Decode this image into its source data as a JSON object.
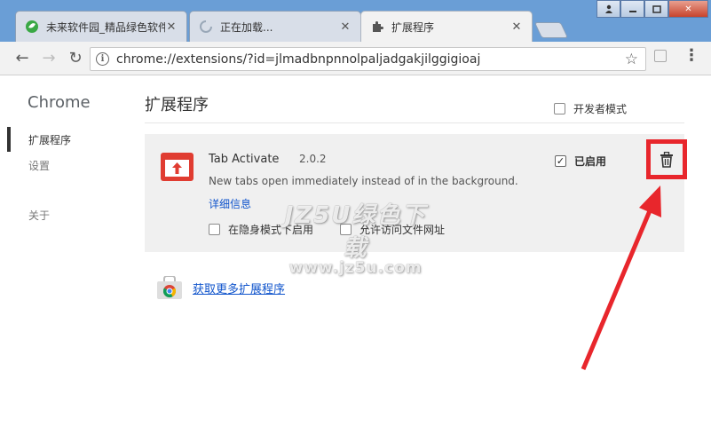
{
  "tabs": [
    {
      "title": "未来软件园_精品绿色软件",
      "icon": "site-leaf-icon",
      "active": false
    },
    {
      "title": "正在加载...",
      "icon": "loading-spinner-icon",
      "active": false
    },
    {
      "title": "扩展程序",
      "icon": "puzzle-piece-icon",
      "active": true
    }
  ],
  "window_controls": {
    "user": "user-icon",
    "minimize": "minimize-icon",
    "restore": "restore-icon",
    "close": "close-icon"
  },
  "omnibox": {
    "url": "chrome://extensions/?id=jlmadbnpnnolpaljadgakjilggigioaj"
  },
  "sidebar": {
    "brand": "Chrome",
    "items": [
      {
        "label": "扩展程序",
        "active": true
      },
      {
        "label": "设置",
        "active": false
      },
      {
        "label": "关于",
        "active": false
      }
    ]
  },
  "main": {
    "title": "扩展程序",
    "developer_mode_label": "开发者模式",
    "extension": {
      "name": "Tab Activate",
      "version": "2.0.2",
      "description": "New tabs open immediately instead of in the background.",
      "details_link": "详细信息",
      "incognito_label": "在隐身模式下启用",
      "file_urls_label": "允许访问文件网址",
      "enabled_label": "已启用",
      "enabled": true
    },
    "get_more_link": "获取更多扩展程序"
  },
  "watermark": {
    "line1": "JZ5U绿色下载",
    "line2": "www.jz5u.com"
  },
  "colors": {
    "tabstrip": "#6a9ed6",
    "highlight": "#e8262c",
    "link": "#1155cc",
    "ext_icon": "#e03c31"
  }
}
